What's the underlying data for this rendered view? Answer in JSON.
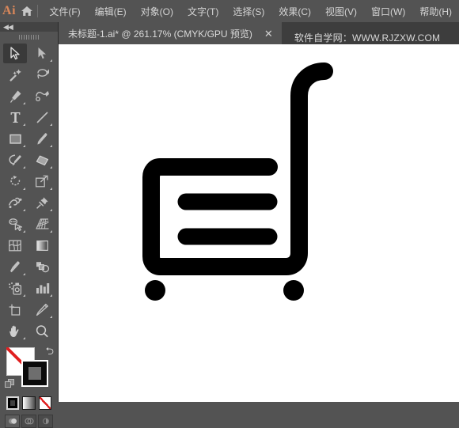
{
  "app": {
    "logo_text": "Ai",
    "home_icon": "home-icon"
  },
  "menubar": {
    "items": [
      {
        "label": "文件(F)",
        "name": "menu-file"
      },
      {
        "label": "编辑(E)",
        "name": "menu-edit"
      },
      {
        "label": "对象(O)",
        "name": "menu-object"
      },
      {
        "label": "文字(T)",
        "name": "menu-type"
      },
      {
        "label": "选择(S)",
        "name": "menu-select"
      },
      {
        "label": "效果(C)",
        "name": "menu-effect"
      },
      {
        "label": "视图(V)",
        "name": "menu-view"
      },
      {
        "label": "窗口(W)",
        "name": "menu-window"
      },
      {
        "label": "帮助(H)",
        "name": "menu-help"
      }
    ]
  },
  "tabbar": {
    "document_title": "未标题-1.ai* @ 261.17% (CMYK/GPU 预览)",
    "close_glyph": "✕",
    "note": "软件自学网：WWW.RJZXW.COM"
  },
  "toolpanel": {
    "collapse_glyph": "◀◀",
    "tools": [
      {
        "name": "selection-tool",
        "icon": "arrow-solid",
        "active": true,
        "corner": false
      },
      {
        "name": "direct-selection-tool",
        "icon": "arrow-filled",
        "active": false,
        "corner": true
      },
      {
        "name": "magic-wand-tool",
        "icon": "magic-wand",
        "active": false,
        "corner": false
      },
      {
        "name": "lasso-tool",
        "icon": "lasso",
        "active": false,
        "corner": false
      },
      {
        "name": "pen-tool",
        "icon": "pen",
        "active": false,
        "corner": true
      },
      {
        "name": "curvature-tool",
        "icon": "curvature",
        "active": false,
        "corner": false
      },
      {
        "name": "type-tool",
        "icon": "type-T",
        "active": false,
        "corner": true
      },
      {
        "name": "line-segment-tool",
        "icon": "line-segment",
        "active": false,
        "corner": true
      },
      {
        "name": "rectangle-tool",
        "icon": "rectangle",
        "active": false,
        "corner": true
      },
      {
        "name": "paintbrush-tool",
        "icon": "paintbrush",
        "active": false,
        "corner": true
      },
      {
        "name": "shaper-pencil-tool",
        "icon": "shaper-pencil",
        "active": false,
        "corner": true
      },
      {
        "name": "eraser-tool",
        "icon": "eraser",
        "active": false,
        "corner": true
      },
      {
        "name": "rotate-tool",
        "icon": "rotate",
        "active": false,
        "corner": true
      },
      {
        "name": "scale-tool",
        "icon": "scale",
        "active": false,
        "corner": true
      },
      {
        "name": "width-tool",
        "icon": "width-warp",
        "active": false,
        "corner": true
      },
      {
        "name": "free-transform-tool",
        "icon": "pushpin",
        "active": false,
        "corner": true
      },
      {
        "name": "shape-builder-tool",
        "icon": "shape-builder",
        "active": false,
        "corner": true
      },
      {
        "name": "perspective-grid-tool",
        "icon": "perspective-grid",
        "active": false,
        "corner": true
      },
      {
        "name": "mesh-tool",
        "icon": "mesh",
        "active": false,
        "corner": false
      },
      {
        "name": "gradient-tool",
        "icon": "gradient",
        "active": false,
        "corner": false
      },
      {
        "name": "eyedropper-tool",
        "icon": "eyedropper",
        "active": false,
        "corner": true
      },
      {
        "name": "blend-tool",
        "icon": "blend",
        "active": false,
        "corner": false
      },
      {
        "name": "symbol-sprayer-tool",
        "icon": "symbol-sprayer",
        "active": false,
        "corner": true
      },
      {
        "name": "column-graph-tool",
        "icon": "column-graph",
        "active": false,
        "corner": true
      },
      {
        "name": "artboard-tool",
        "icon": "artboard",
        "active": false,
        "corner": false
      },
      {
        "name": "slice-tool",
        "icon": "slice-knife",
        "active": false,
        "corner": true
      },
      {
        "name": "hand-tool",
        "icon": "hand",
        "active": false,
        "corner": true
      },
      {
        "name": "zoom-tool",
        "icon": "magnifier",
        "active": false,
        "corner": false
      }
    ],
    "color": {
      "fill_color": "#ffffff",
      "fill_is_none": true,
      "stroke_color": "#000000",
      "swap_glyph": "⤵",
      "swatches": [
        {
          "name": "color-swatch-button",
          "kind": "solid"
        },
        {
          "name": "gradient-swatch-button",
          "kind": "grad"
        },
        {
          "name": "none-swatch-button",
          "kind": "none"
        }
      ],
      "draw_modes": [
        {
          "name": "draw-normal-button",
          "selected": true
        },
        {
          "name": "draw-behind-button",
          "selected": false
        },
        {
          "name": "draw-inside-button",
          "selected": false
        }
      ]
    }
  },
  "canvas": {
    "artwork_name": "shopping-cart-icon",
    "artwork_color": "#000000",
    "background": "#ffffff",
    "zoom_level": "261.17%"
  }
}
